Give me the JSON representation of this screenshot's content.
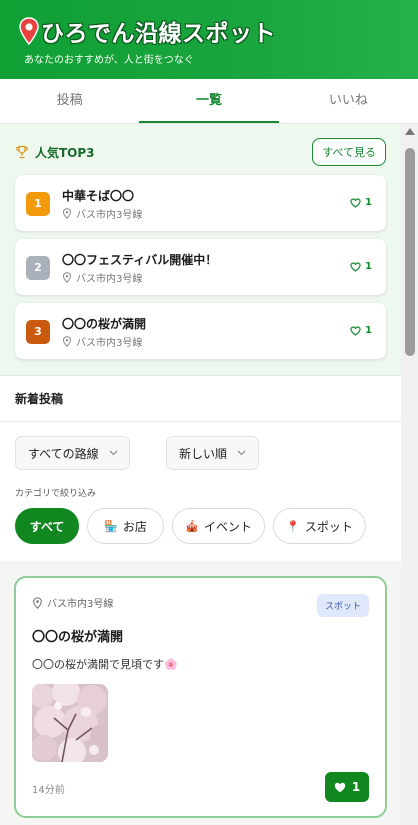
{
  "header": {
    "title": "ひろでん沿線スポット",
    "subtitle": "あなたのおすすめが、人と街をつなぐ",
    "logo_icon": "map-pin-icon",
    "background": "#17a33b"
  },
  "tabs": [
    {
      "label": "投稿",
      "active": false
    },
    {
      "label": "一覧",
      "active": true
    },
    {
      "label": "いいね",
      "active": false
    }
  ],
  "top3": {
    "title": "人気TOP3",
    "see_all_label": "すべて見る",
    "items": [
      {
        "rank": "1",
        "name": "中華そば〇〇",
        "location": "バス市内3号線",
        "likes": "1",
        "badge_color": "#f39a0c"
      },
      {
        "rank": "2",
        "name": "〇〇フェスティバル開催中！",
        "location": "バス市内3号線",
        "likes": "1",
        "badge_color": "#aab1bb"
      },
      {
        "rank": "3",
        "name": "〇〇の桜が満開",
        "location": "バス市内3号線",
        "likes": "1",
        "badge_color": "#c9590c"
      }
    ]
  },
  "new_posts": {
    "title": "新着投稿",
    "route_select": "すべての路線",
    "sort_select": "新しい順",
    "category_label": "カテゴリで絞り込み",
    "categories": [
      {
        "label": "すべて",
        "icon": "",
        "active": true
      },
      {
        "label": "お店",
        "icon": "🏪",
        "active": false
      },
      {
        "label": "イベント",
        "icon": "🎪",
        "active": false
      },
      {
        "label": "スポット",
        "icon": "📍",
        "active": false
      }
    ]
  },
  "posts": [
    {
      "location": "バス市内3号線",
      "category": "スポット",
      "title": "〇〇の桜が満開",
      "body": "〇〇の桜が満開で見頃です🌸",
      "time": "14分前",
      "likes": "1",
      "photo": "cherry-blossom-photo"
    }
  ],
  "colors": {
    "accent": "#1a8a34",
    "like_button": "#10871f",
    "card_border": "#8fcd97"
  }
}
